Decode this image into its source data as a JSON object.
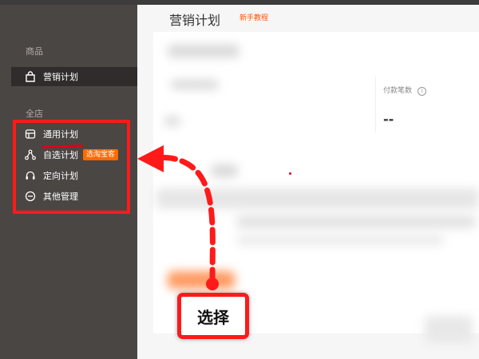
{
  "sidebar": {
    "section_product": "商品",
    "marketing_plan": "营销计划",
    "section_store": "全店",
    "items": [
      {
        "label": "通用计划",
        "icon": "store-icon"
      },
      {
        "label": "自选计划",
        "icon": "share-node-icon",
        "badge": "选淘宝客"
      },
      {
        "label": "定向计划",
        "icon": "headset-icon"
      },
      {
        "label": "其他管理",
        "icon": "minus-circle-icon"
      }
    ]
  },
  "header": {
    "title": "营销计划",
    "tutorial_link": "新手教程"
  },
  "stats": {
    "payments_label": "付款笔数",
    "payments_info": "i",
    "payments_value": "--"
  },
  "callout": {
    "label": "选择"
  },
  "colors": {
    "sidebar_bg": "#4a4644",
    "accent": "#ff6a00",
    "highlight_red": "#ff1a1a"
  }
}
